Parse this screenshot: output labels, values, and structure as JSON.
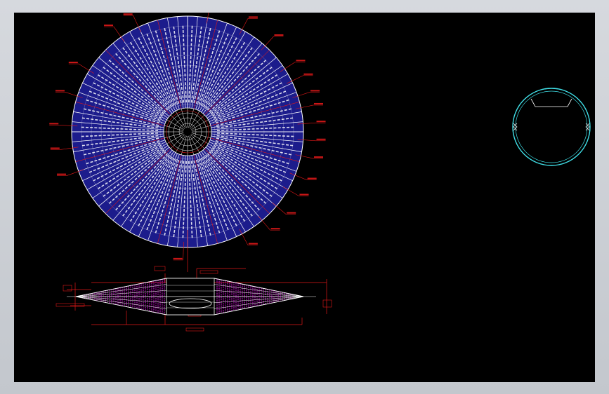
{
  "colors": {
    "background": "#000000",
    "frame": "#c8ccd2",
    "outline": "#ffffff",
    "fill": "#1c1c8c",
    "dimension": "#e01818",
    "hatch": "#d010d8",
    "detail": "#40e0e8"
  },
  "drawing": {
    "plan_view": "circular-radial-panel-plan",
    "elevation_view": "lens-section-elevation",
    "detail_view": "ring-detail"
  }
}
